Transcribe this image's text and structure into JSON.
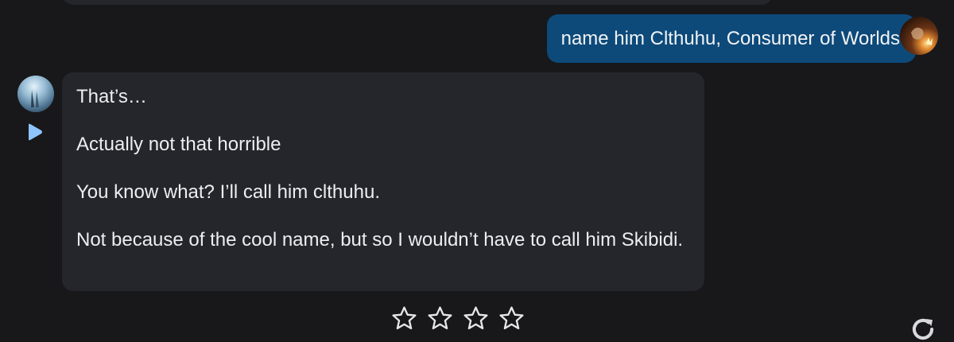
{
  "user_message": {
    "text": "name him Clthuhu, Consumer of Worlds",
    "bubble_color": "#0d4a7a"
  },
  "bot_message": {
    "paragraphs": [
      "That’s…",
      "Actually not that horrible",
      "You know what? I’ll call him clthuhu.",
      "Not because of the cool name, but so I wouldn’t have to call him Skibidi."
    ],
    "bubble_color": "#24262c"
  },
  "rating": {
    "stars_total": 4,
    "stars_filled": 0
  },
  "icons": {
    "play": "play-icon",
    "star": "star-outline-icon",
    "refresh": "refresh-icon"
  },
  "accent_color": "#8ec5ff"
}
